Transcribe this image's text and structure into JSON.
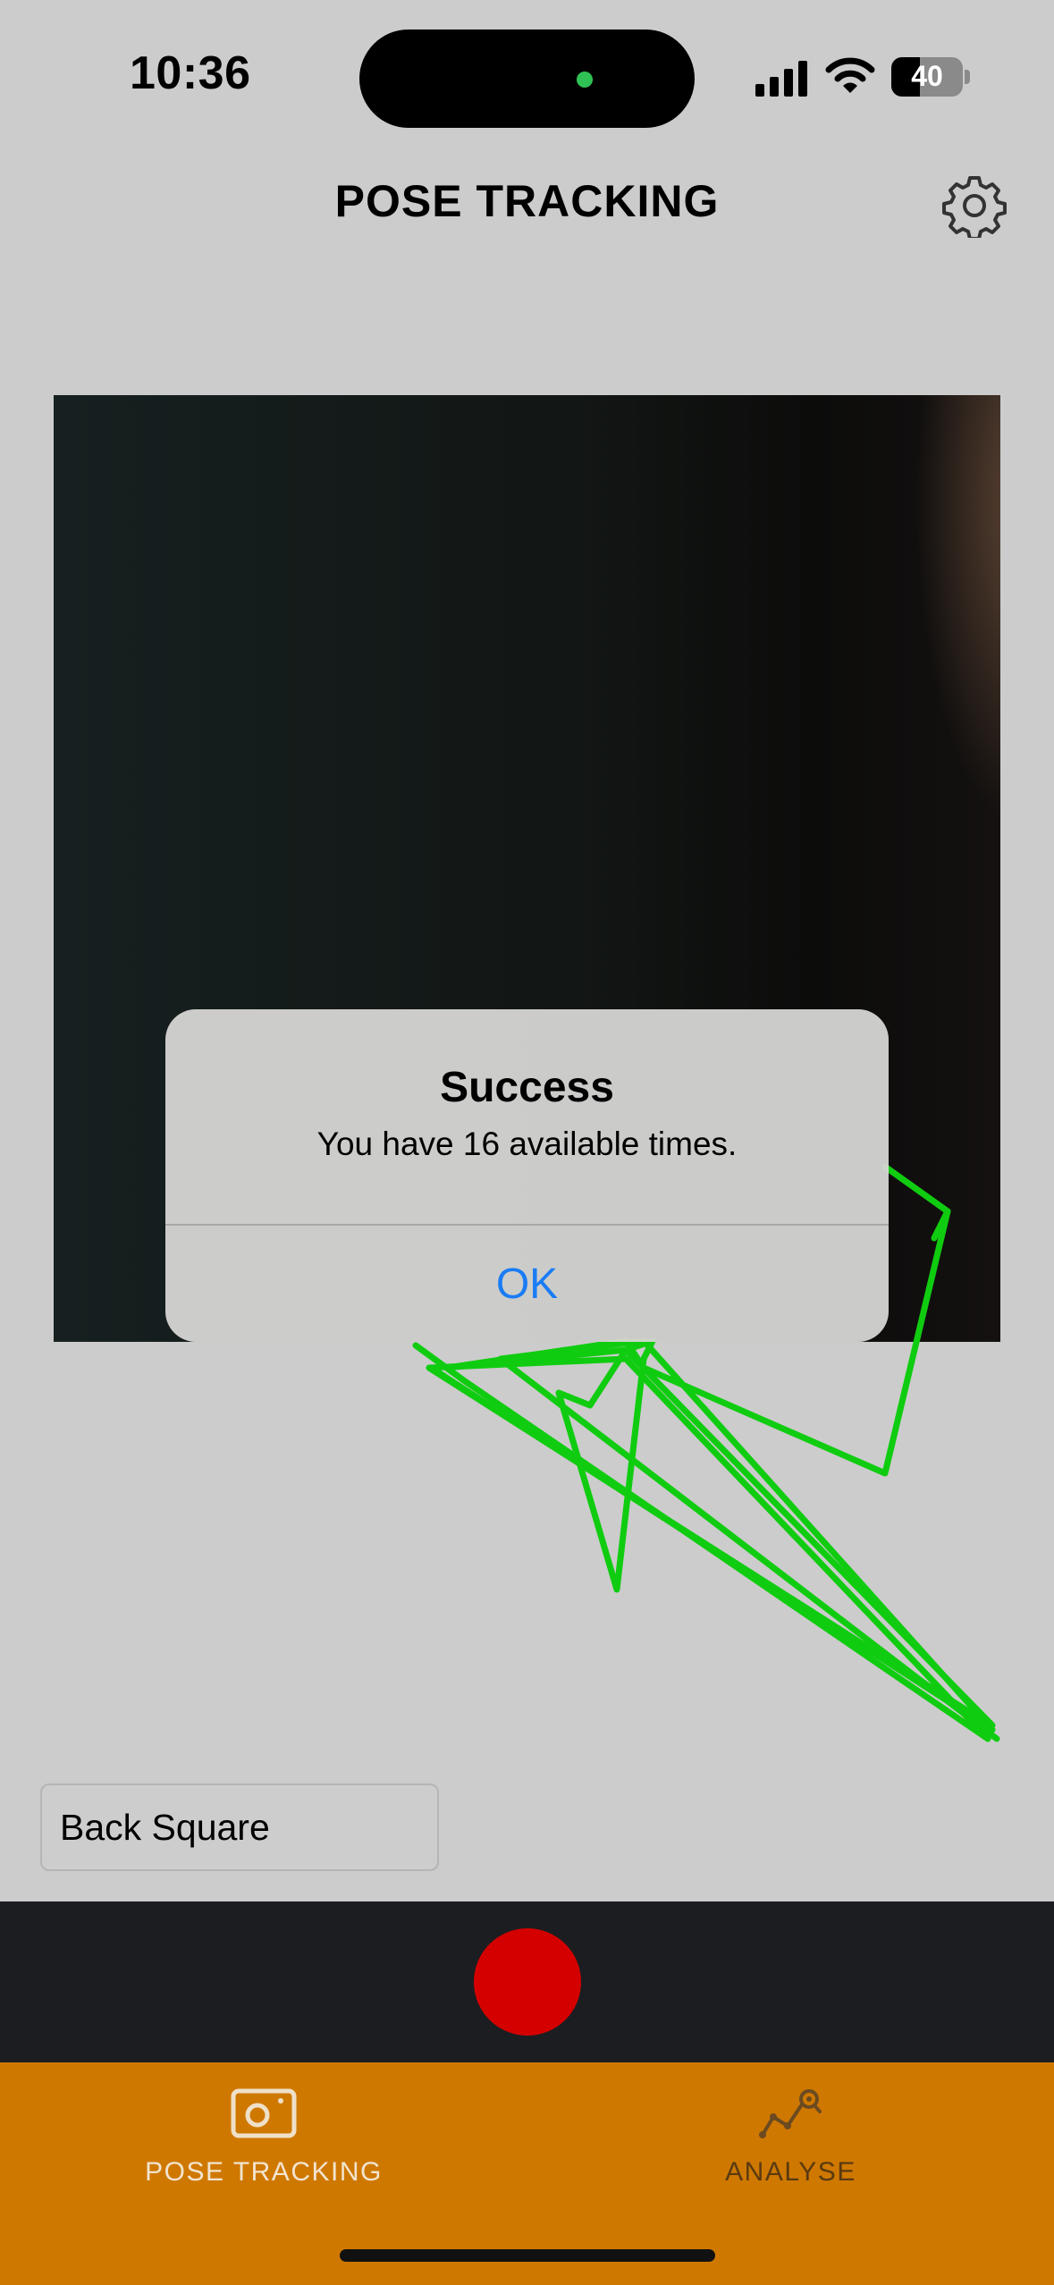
{
  "status_bar": {
    "time": "10:36",
    "battery_level": "40",
    "battery_fraction": 0.4
  },
  "header": {
    "title": "POSE TRACKING",
    "settings_icon": "gear-icon"
  },
  "alert": {
    "title": "Success",
    "message": "You have 16 available times.",
    "ok_label": "OK",
    "ok_color": "#1a7cf5"
  },
  "exercise_selector": {
    "value": "Back Square"
  },
  "record": {
    "color": "#d40000"
  },
  "tabs": [
    {
      "label": "POSE TRACKING",
      "icon": "camera-icon",
      "selected": true
    },
    {
      "label": "ANALYSE",
      "icon": "analytics-icon",
      "selected": false
    }
  ],
  "colors": {
    "tab_bar": "#cf7800",
    "record_bar": "#1c1d21",
    "pose_lines": "#10cc10",
    "background": "#cccccc"
  }
}
